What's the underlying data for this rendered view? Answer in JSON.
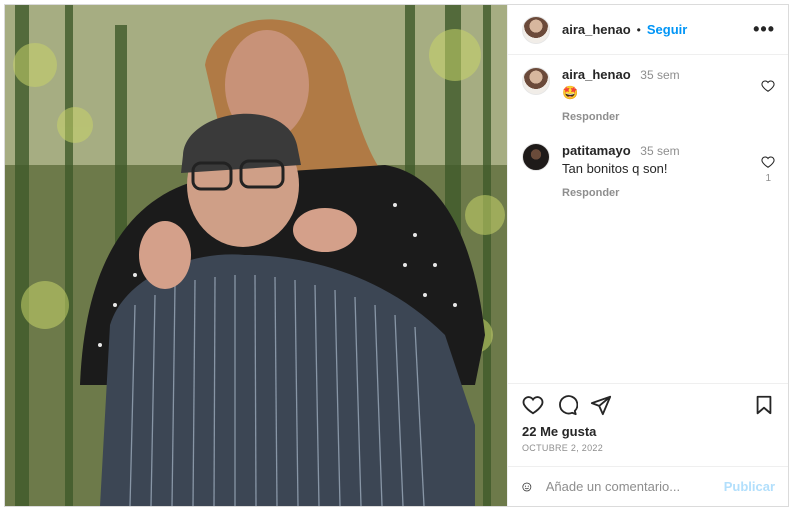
{
  "post": {
    "author": "aira_henao",
    "follow_label": "Seguir",
    "more_label": "•••",
    "dot": "•"
  },
  "comments": [
    {
      "user": "aira_henao",
      "time": "35 sem",
      "text": "🤩",
      "reply_label": "Responder",
      "likes": ""
    },
    {
      "user": "patitamayo",
      "time": "35 sem",
      "text": "Tan bonitos q son!",
      "reply_label": "Responder",
      "likes": "1"
    }
  ],
  "actions": {
    "likes_text": "22 Me gusta",
    "date_text": "OCTUBRE 2, 2022"
  },
  "composer": {
    "placeholder": "Añade un comentario...",
    "publish_label": "Publicar"
  },
  "icons": [
    "heart-icon",
    "comment-icon",
    "share-icon",
    "save-icon",
    "emoji-icon",
    "more-icon"
  ]
}
